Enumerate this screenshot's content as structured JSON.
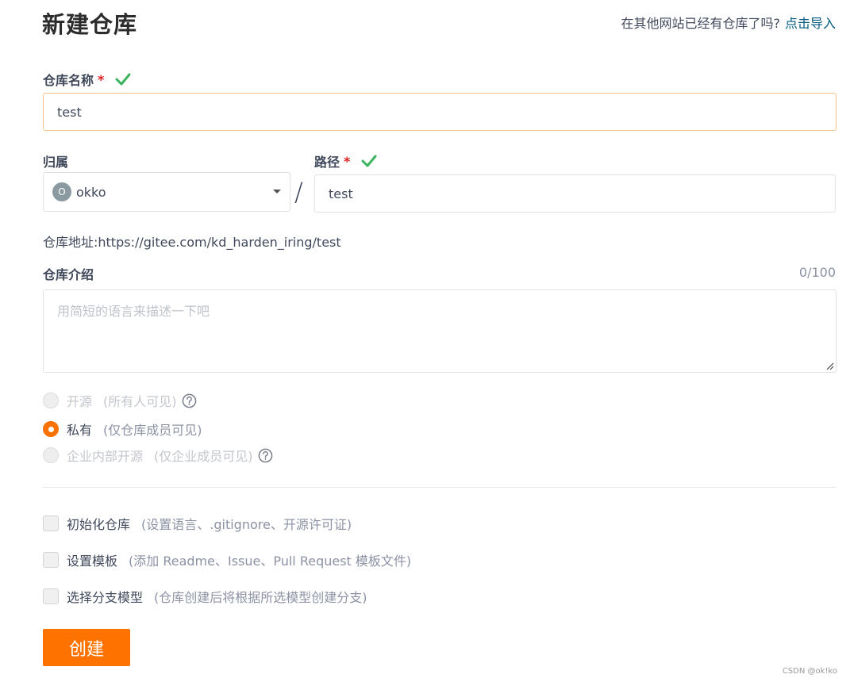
{
  "header": {
    "title": "新建仓库",
    "import_question": "在其他网站已经有仓库了吗?",
    "import_link": "点击导入"
  },
  "repo_name": {
    "label": "仓库名称",
    "required_mark": "*",
    "value": "test"
  },
  "owner": {
    "label": "归属",
    "avatar_letter": "O",
    "value": "okko"
  },
  "separator": "/",
  "path": {
    "label": "路径",
    "required_mark": "*",
    "value": "test"
  },
  "repo_url": "仓库地址:https://gitee.com/kd_harden_iring/test",
  "description": {
    "label": "仓库介绍",
    "counter": "0/100",
    "placeholder": "用简短的语言来描述一下吧"
  },
  "visibility": [
    {
      "label": "开源",
      "sub": "(所有人可见)",
      "checked": false,
      "disabled": true,
      "help": true
    },
    {
      "label": "私有",
      "sub": "(仅仓库成员可见)",
      "checked": true,
      "disabled": false,
      "help": false
    },
    {
      "label": "企业内部开源",
      "sub": "(仅企业成员可见)",
      "checked": false,
      "disabled": true,
      "help": true
    }
  ],
  "options": [
    {
      "label": "初始化仓库",
      "sub": "(设置语言、.gitignore、开源许可证)"
    },
    {
      "label": "设置模板",
      "sub": "(添加 Readme、Issue、Pull Request 模板文件)"
    },
    {
      "label": "选择分支模型",
      "sub": "(仓库创建后将根据所选模型创建分支)"
    }
  ],
  "submit_label": "创建",
  "watermark": "CSDN @ok!ko",
  "colors": {
    "accent": "#fe7300",
    "success": "#3cb35e",
    "link": "#005980",
    "required": "#e02020"
  }
}
